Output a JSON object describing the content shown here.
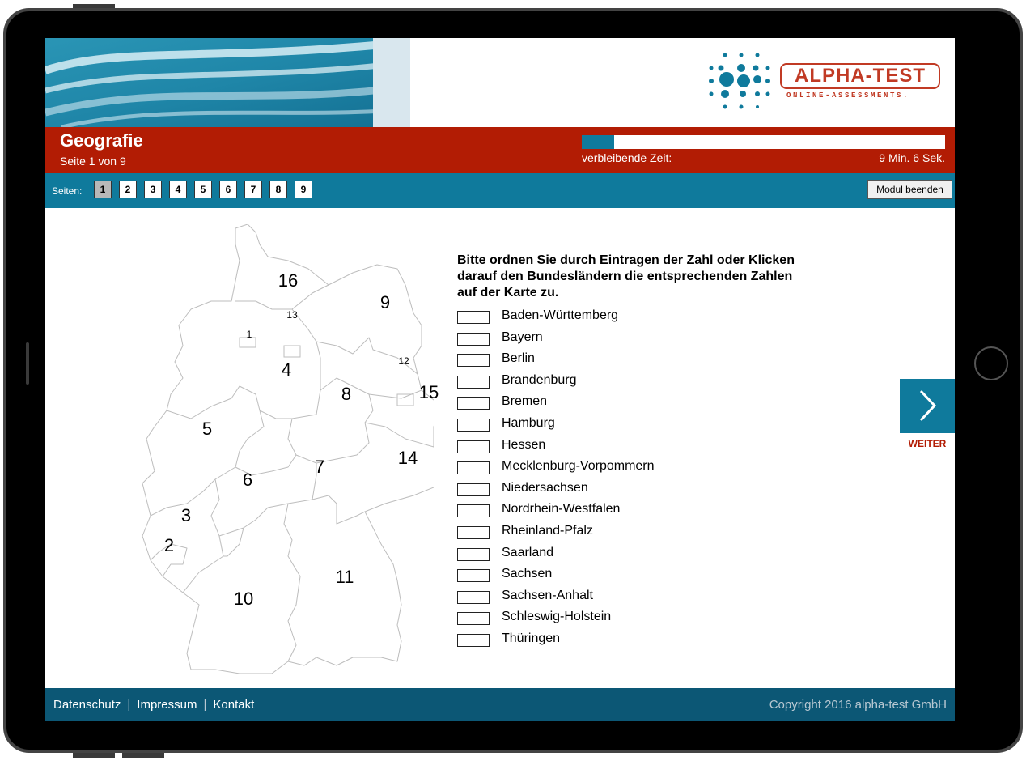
{
  "header": {
    "logo_name": "ALPHA-TEST",
    "logo_sub": "ONLINE-ASSESSMENTS."
  },
  "module": {
    "title": "Geografie",
    "page_info": "Seite 1 von 9",
    "time_label": "verbleibende Zeit:",
    "time_value": "9 Min. 6 Sek.",
    "time_progress": 0.09
  },
  "nav": {
    "pages_label": "Seiten:",
    "pages": [
      "1",
      "2",
      "3",
      "4",
      "5",
      "6",
      "7",
      "8",
      "9"
    ],
    "active_page": "1",
    "end_button": "Modul beenden"
  },
  "map": {
    "numbers": [
      "1",
      "2",
      "3",
      "4",
      "5",
      "6",
      "7",
      "8",
      "9",
      "10",
      "11",
      "12",
      "13",
      "14",
      "15",
      "16"
    ]
  },
  "question": {
    "instruction": "Bitte ordnen Sie durch Eintragen der Zahl oder Klicken darauf den Bundesländern die entsprechenden Zahlen auf der Karte zu.",
    "states": [
      "Baden-Württemberg",
      "Bayern",
      "Berlin",
      "Brandenburg",
      "Bremen",
      "Hamburg",
      "Hessen",
      "Mecklenburg-Vorpommern",
      "Niedersachsen",
      "Nordrhein-Westfalen",
      "Rheinland-Pfalz",
      "Saarland",
      "Sachsen",
      "Sachsen-Anhalt",
      "Schleswig-Holstein",
      "Thüringen"
    ],
    "answers": [
      "",
      "",
      "",
      "",
      "",
      "",
      "",
      "",
      "",
      "",
      "",
      "",
      "",
      "",
      "",
      ""
    ]
  },
  "next_button": {
    "label": "WEITER"
  },
  "footer": {
    "links": [
      "Datenschutz",
      "Impressum",
      "Kontakt"
    ],
    "copyright": "Copyright 2016 alpha-test GmbH"
  },
  "colors": {
    "brand_red": "#b21c04",
    "teal": "#0f7a9c",
    "footer": "#0c5775",
    "logo_red": "#c13a24"
  }
}
